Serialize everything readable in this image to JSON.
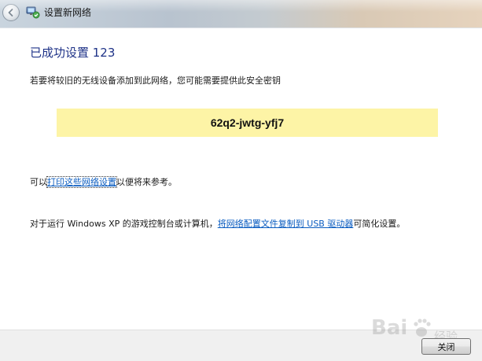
{
  "window": {
    "title": "设置新网络"
  },
  "main": {
    "heading": "已成功设置 123",
    "description": "若要将较旧的无线设备添加到此网络，您可能需要提供此安全密钥",
    "security_key": "62q2-jwtg-yfj7",
    "print_prefix": "可以",
    "print_link": "打印这些网络设置",
    "print_suffix": "以便将来参考。",
    "xp_prefix": "对于运行 Windows XP 的游戏控制台或计算机，",
    "xp_link": "将网络配置文件复制到 USB 驱动器",
    "xp_suffix": "可简化设置。"
  },
  "footer": {
    "close_label": "关闭"
  },
  "watermark": {
    "brand": "Bai",
    "suffix": "经验"
  },
  "colors": {
    "heading": "#1e3287",
    "link": "#0a5cc0",
    "key_background": "#fdf4a6",
    "footer_background": "#f0f0f0"
  },
  "icons": {
    "back": "back-arrow-icon",
    "app": "network-setup-icon",
    "watermark": "baidu-paw-icon"
  }
}
